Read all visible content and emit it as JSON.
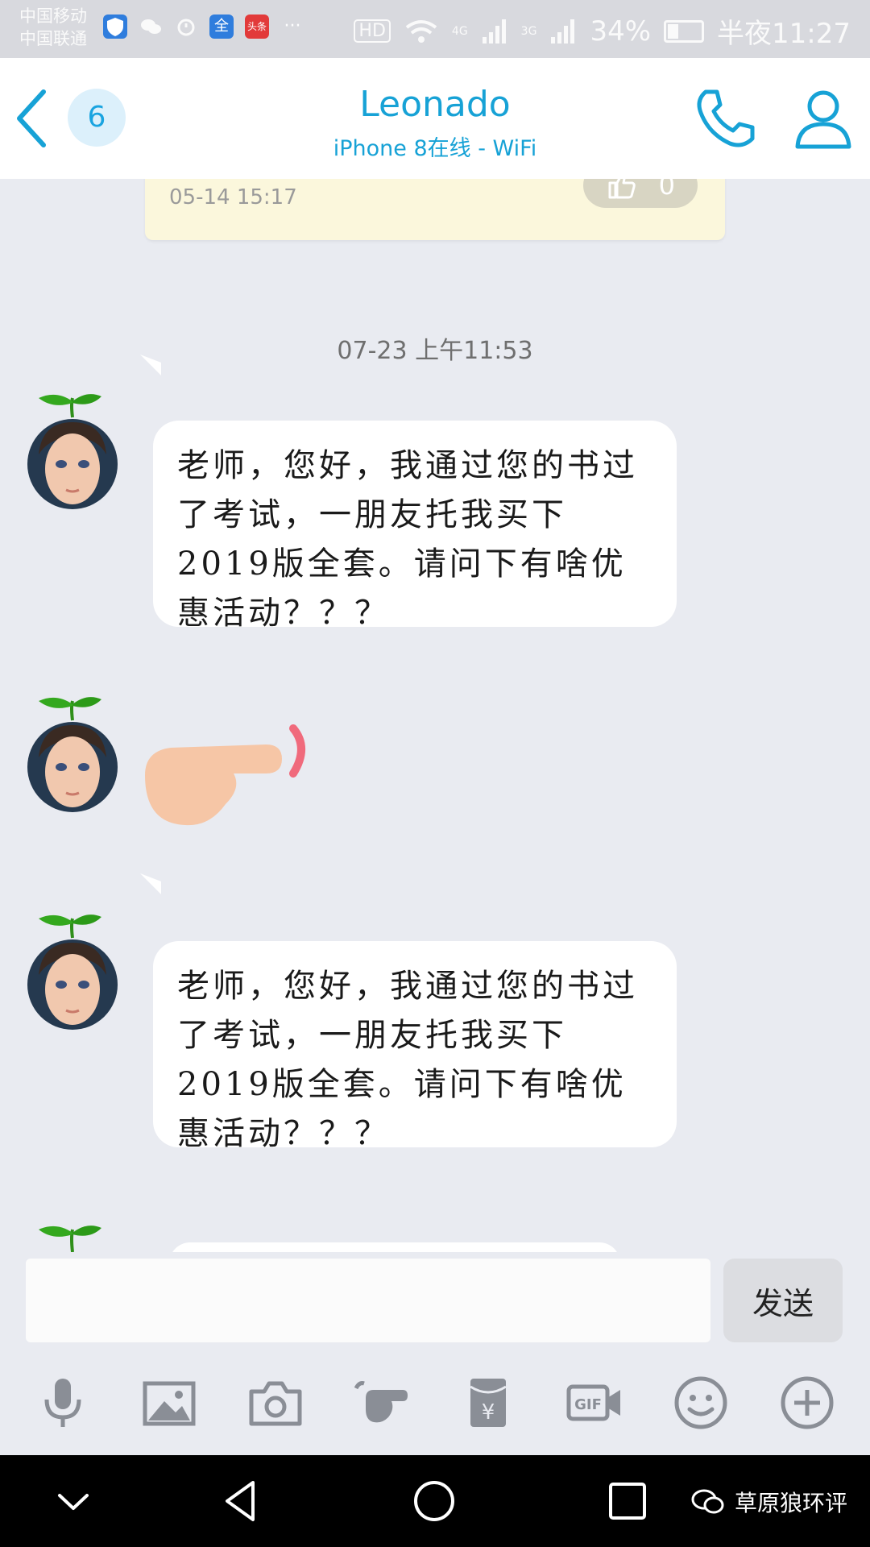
{
  "status_bar": {
    "carrier_1": "中国移动",
    "carrier_2": "中国联通",
    "network_4g": "4G",
    "network_3g": "3G",
    "hd": "HD",
    "battery_text": "34%",
    "battery_level": 0.34,
    "time": "半夜11:27",
    "app_icon_quan": "全",
    "app_icon_toutiao": "头条",
    "more": "···"
  },
  "header": {
    "unread_count": "6",
    "contact_name": "Leonado",
    "contact_status": "iPhone 8在线 - WiFi"
  },
  "chat": {
    "previous_card": {
      "timestamp": "05-14 15:17",
      "likes": "0"
    },
    "date_separator": "07-23 上午11:53",
    "messages": [
      {
        "type": "text",
        "text": "老师，您好，我通过您的书过了考试，一朋友托我买下2019版全套。请问下有啥优惠活动？？？"
      },
      {
        "type": "sticker",
        "icon": "pointing-hand"
      },
      {
        "type": "text",
        "text": "老师，您好，我通过您的书过了考试，一朋友托我买下2019版全套。请问下有啥优惠活动？？？"
      }
    ]
  },
  "input": {
    "value": "",
    "placeholder": "",
    "send_label": "发送"
  },
  "toolbar": {
    "items": [
      "microphone-icon",
      "image-icon",
      "camera-icon",
      "poke-hand-icon",
      "red-packet-icon",
      "gif-icon",
      "emoji-icon",
      "plus-icon"
    ],
    "red_packet_symbol": "¥",
    "gif_label": "GIF"
  },
  "navbar": {
    "watermark": "草原狼环评"
  },
  "colors": {
    "accent": "#17a2d6",
    "background": "#e9ebf1",
    "bubble": "#ffffff"
  }
}
